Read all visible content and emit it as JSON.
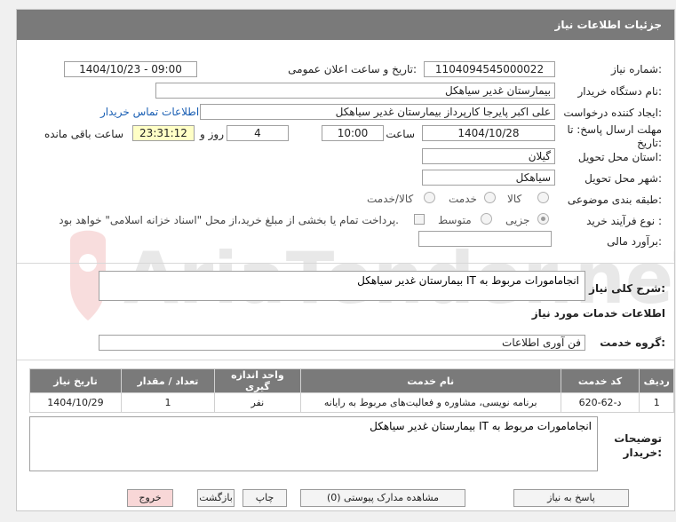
{
  "header": {
    "title": "جزئیات اطلاعات نیاز"
  },
  "form": {
    "need_number_label": "شماره نیاز:",
    "need_number": "1104094545000022",
    "announce_label": "تاریخ و ساعت اعلان عمومی:",
    "announce_value": "1404/10/23 - 09:00",
    "buyer_org_label": "نام دستگاه خریدار:",
    "buyer_org": "بیمارستان غدیر سیاهکل",
    "requester_label": "ایجاد کننده درخواست:",
    "requester": "علی اکبر پایرجا کارپرداز بیمارستان غدیر سیاهکل",
    "contact_link": "اطلاعات تماس خریدار",
    "deadline_label_1": "مهلت ارسال پاسخ: تا",
    "deadline_label_2": "تاریخ:",
    "deadline_date": "1404/10/28",
    "time_label": "ساعت",
    "deadline_time": "10:00",
    "days": "4",
    "days_label": "روز و",
    "remaining": "23:31:12",
    "remaining_label": "ساعت باقی مانده",
    "province_label": "استان محل تحویل:",
    "province": "گیلان",
    "city_label": "شهر محل تحویل:",
    "city": "سیاهکل",
    "category_label": "طبقه بندی موضوعی:",
    "category_options": [
      "کالا",
      "خدمت",
      "کالا/خدمت"
    ],
    "process_label": "نوع فرآیند خرید :",
    "process_options": [
      "جزیی",
      "متوسط"
    ],
    "payment_note": "پرداخت تمام یا بخشی از مبلغ خرید،از محل \"اسناد خزانه اسلامی\" خواهد بود.",
    "estimate_label": "برآورد مالی:",
    "estimate": ""
  },
  "need": {
    "summary_label": "شرح کلی نیاز:",
    "summary": "انجامامورات مربوط به IT بیمارستان غدیر سیاهکل",
    "services_title": "اطلاعات خدمات مورد نیاز",
    "group_label": "گروه خدمت:",
    "group": "فن آوری اطلاعات"
  },
  "table": {
    "headers": [
      "ردیف",
      "کد خدمت",
      "نام خدمت",
      "واحد اندازه گیری",
      "تعداد / مقدار",
      "تاریخ نیاز"
    ],
    "rows": [
      [
        "1",
        "د-62-620",
        "برنامه نویسی، مشاوره و فعالیت‌های مربوط به رایانه",
        "نفر",
        "1",
        "1404/10/29"
      ]
    ]
  },
  "buyer_notes": {
    "label_1": "توضیحات",
    "label_2": "خریدار:",
    "text": "انجامامورات مربوط به IT بیمارستان غدیر سیاهکل"
  },
  "buttons": {
    "reply": "پاسخ به نیاز",
    "attachments": "مشاهده مدارک پیوستی (0)",
    "print": "چاپ",
    "back": "بازگشت",
    "exit": "خروج"
  },
  "watermark": {
    "text": "AriaTender.neT"
  },
  "colors": {
    "header_bg": "#7a7a7a",
    "link": "#1a5fb4",
    "remaining_bg": "#ffffc6",
    "exit_bg": "#f8d7d7"
  }
}
